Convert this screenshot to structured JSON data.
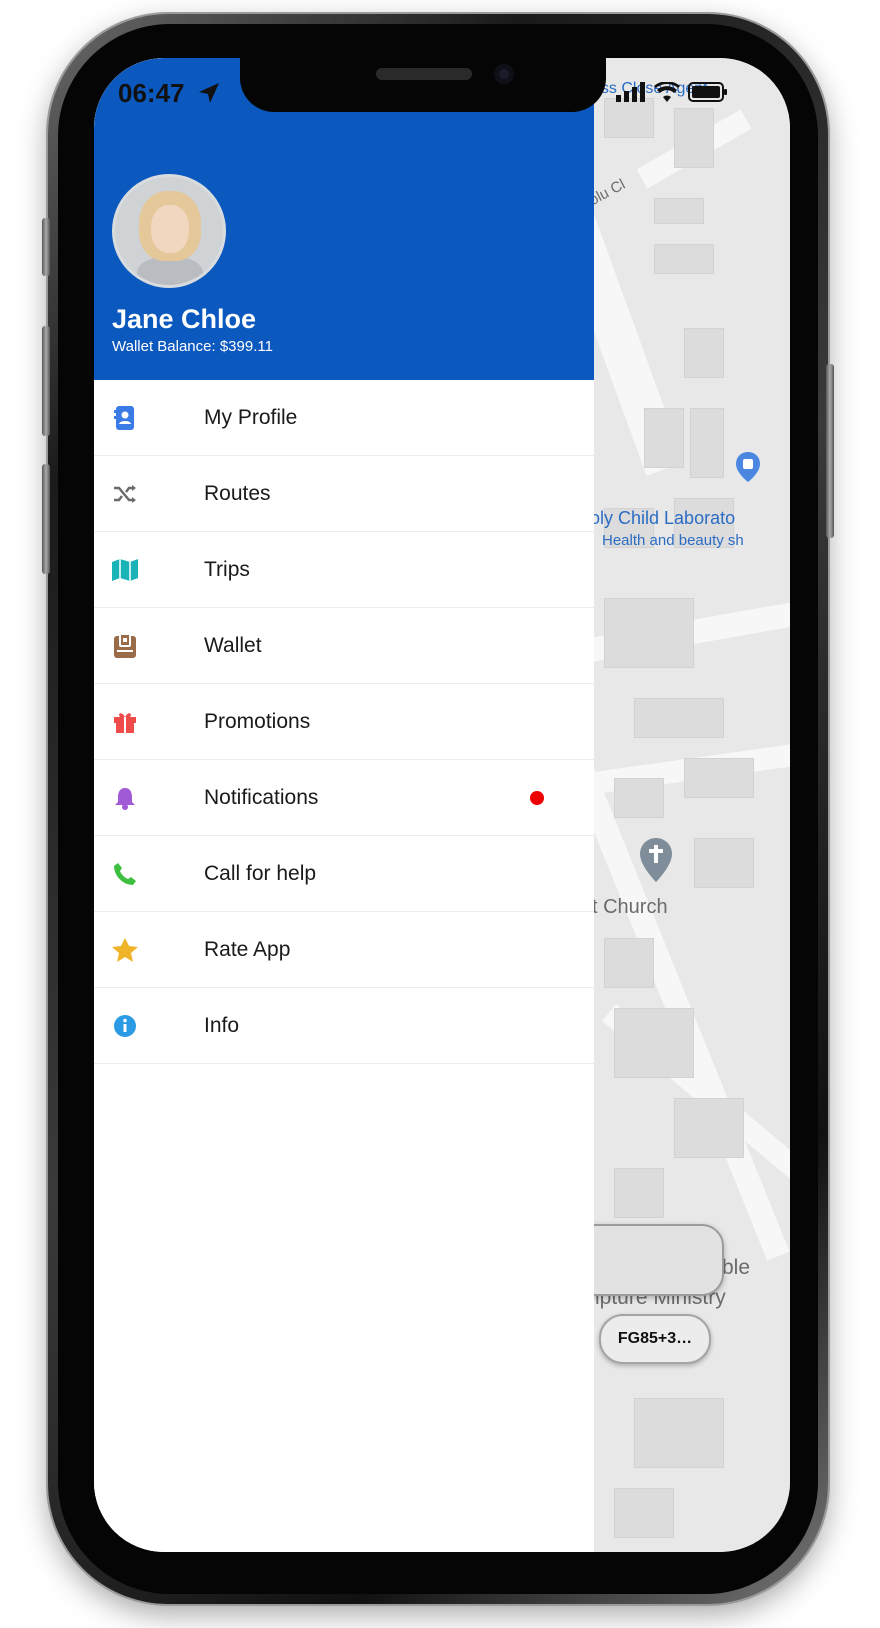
{
  "status_bar": {
    "time": "06:47"
  },
  "profile": {
    "name": "Jane Chloe",
    "wallet_balance": "Wallet Balance: $399.11"
  },
  "menu": {
    "items": [
      {
        "label": "My Profile",
        "icon": "contact-book-icon",
        "color": "#3b7be6"
      },
      {
        "label": "Routes",
        "icon": "shuffle-icon",
        "color": "#6b6b6b"
      },
      {
        "label": "Trips",
        "icon": "map-icon",
        "color": "#19b3b8"
      },
      {
        "label": "Wallet",
        "icon": "wallet-icon",
        "color": "#9a6b48"
      },
      {
        "label": "Promotions",
        "icon": "gift-icon",
        "color": "#f04b4b"
      },
      {
        "label": "Notifications",
        "icon": "bell-icon",
        "color": "#a05ad6",
        "has_unread_dot": true
      },
      {
        "label": "Call for help",
        "icon": "phone-icon",
        "color": "#3fbf3f"
      },
      {
        "label": "Rate App",
        "icon": "star-icon",
        "color": "#f0b429"
      },
      {
        "label": "Info",
        "icon": "info-icon",
        "color": "#2b9be6"
      }
    ]
  },
  "map": {
    "labels": {
      "top": "ess Close Agent",
      "street": "olu Cl",
      "place": "oly Child Laborato",
      "place_sub": "Health and beauty sh",
      "church": "t Church",
      "bottom_1": "ble",
      "bottom_2": "ripture Ministry"
    },
    "plus_code": "FG85+3…"
  },
  "colors": {
    "header": "#0b58be",
    "notification_dot": "#ee0000"
  }
}
